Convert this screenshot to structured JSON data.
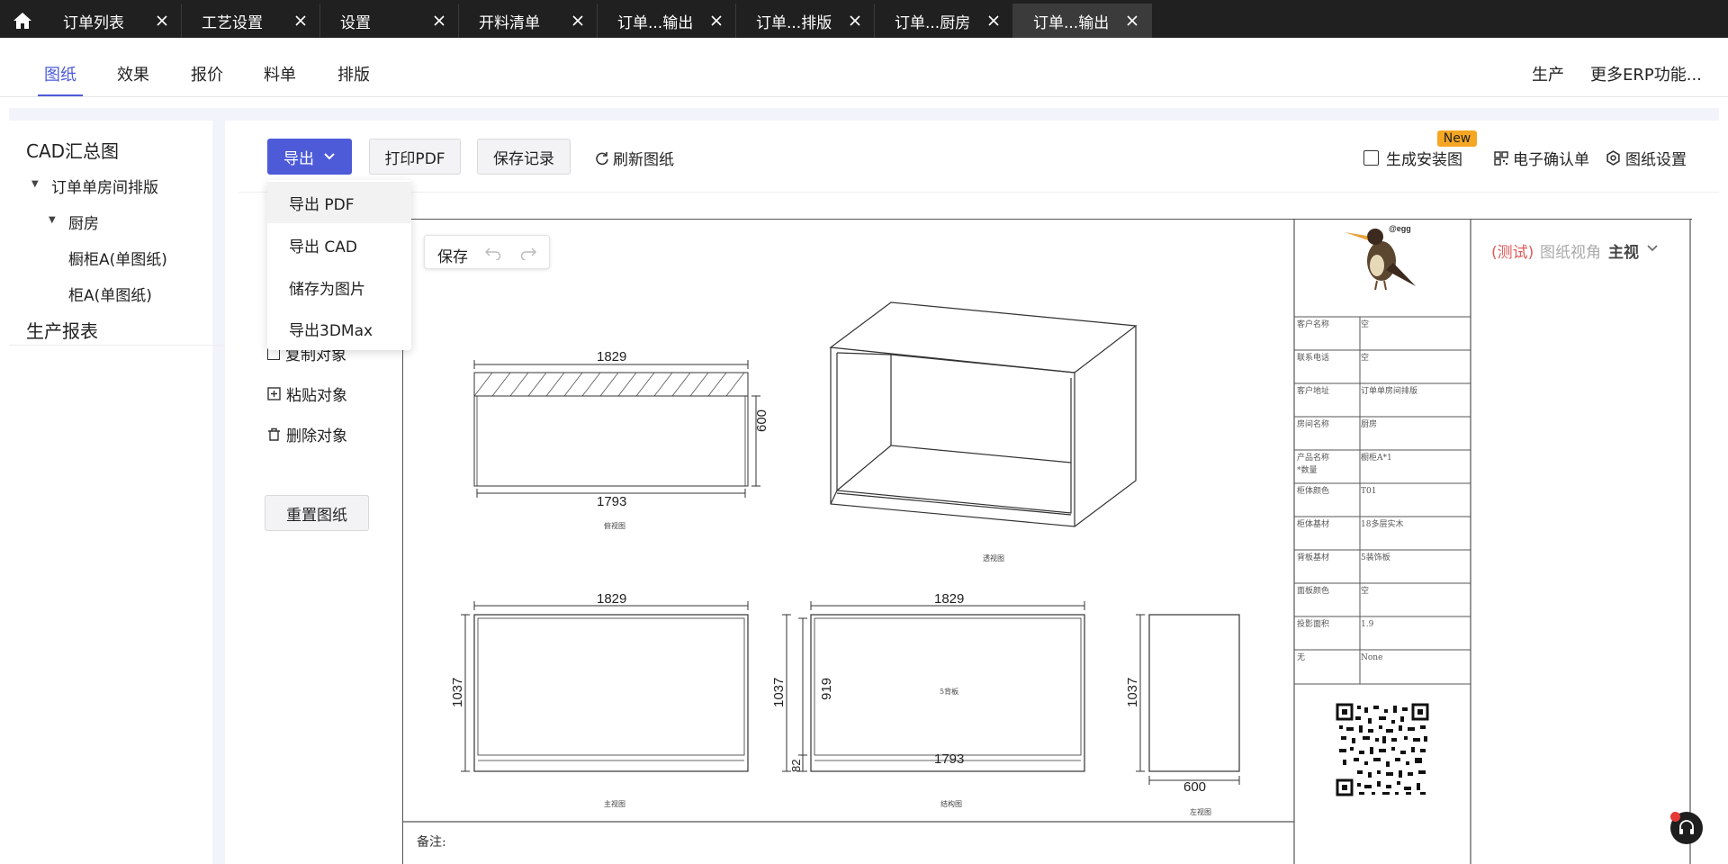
{
  "tabs": [
    {
      "label": "订单列表"
    },
    {
      "label": "工艺设置"
    },
    {
      "label": "设置"
    },
    {
      "label": "开料清单"
    },
    {
      "label": "订单...输出"
    },
    {
      "label": "订单...排版"
    },
    {
      "label": "订单...厨房"
    },
    {
      "label": "订单...输出"
    }
  ],
  "subnav": {
    "items": [
      {
        "label": "图纸"
      },
      {
        "label": "效果"
      },
      {
        "label": "报价"
      },
      {
        "label": "料单"
      },
      {
        "label": "排版"
      }
    ],
    "right": [
      {
        "label": "生产"
      },
      {
        "label": "更多ERP功能..."
      }
    ],
    "active": "图纸"
  },
  "sidebar": {
    "root1": "CAD汇总图",
    "group": "订单单房间排版",
    "room": "厨房",
    "leaf1": "橱柜A(单图纸)",
    "leaf2": "柜A(单图纸)",
    "root2": "生产报表"
  },
  "toolbar": {
    "export": "导出",
    "print_pdf": "打印PDF",
    "save_record": "保存记录",
    "refresh": "刷新图纸",
    "gen_install": "生成安装图",
    "new_badge": "New",
    "e_confirm": "电子确认单",
    "drawing_settings": "图纸设置"
  },
  "export_menu": {
    "items": [
      {
        "label": "导出 PDF"
      },
      {
        "label": "导出 CAD"
      },
      {
        "label": "储存为图片"
      },
      {
        "label": "导出3DMax"
      }
    ]
  },
  "side_tools": {
    "copy": "复制对象",
    "paste": "粘贴对象",
    "delete": "删除对象",
    "reset": "重置图纸"
  },
  "editor": {
    "save": "保存"
  },
  "view_selector": {
    "test": "(测试)",
    "label": "图纸视角",
    "value": "主视"
  },
  "drawing": {
    "dims": {
      "top_width": "1829",
      "top_bottom_width": "1793",
      "top_height": "600",
      "front_width": "1829",
      "front_height": "1037",
      "struct_width": "1829",
      "struct_height": "1037",
      "struct_inner_height": "919",
      "struct_bottom": "1793",
      "struct_plinth": "82",
      "side_height": "1037",
      "side_width": "600"
    },
    "captions": {
      "top_view": "俯视图",
      "perspective": "透视图",
      "front_view": "主视图",
      "structure_view": "结构图",
      "left_view": "左视图",
      "back_panel": "5背板"
    },
    "notes_label": "备注:",
    "logo_tag": "@egg"
  },
  "info_table": [
    {
      "label": "客户名称",
      "value": "空"
    },
    {
      "label": "联系电话",
      "value": "空"
    },
    {
      "label": "客户地址",
      "value": "订单单房间排版"
    },
    {
      "label": "房间名称",
      "value": "厨房"
    },
    {
      "label": "产品名称\n*数量",
      "value": "橱柜A*1"
    },
    {
      "label": "柜体颜色",
      "value": "T01"
    },
    {
      "label": "柜体基材",
      "value": "18多层实木"
    },
    {
      "label": "背板基材",
      "value": "5装饰板"
    },
    {
      "label": "面板颜色",
      "value": "空"
    },
    {
      "label": "投影面积",
      "value": "1.9"
    },
    {
      "label": "无",
      "value": "None"
    }
  ],
  "colors": {
    "accent": "#4d5bd9",
    "tabbar": "#202020",
    "badge": "#f5a623",
    "test_red": "#e05a5a"
  }
}
